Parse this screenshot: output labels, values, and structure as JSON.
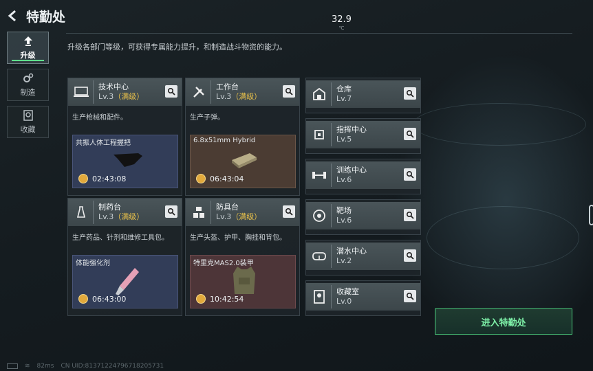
{
  "header": {
    "title": "特勤处",
    "temperature": "32.9",
    "temperature_unit": "℃"
  },
  "description": "升级各部门等级，可获得专属能力提升，和制造战斗物资的能力。",
  "sidebar": [
    {
      "label": "升级",
      "icon": "upgrade-icon",
      "active": true
    },
    {
      "label": "制造",
      "icon": "gears-icon",
      "active": false
    },
    {
      "label": "收藏",
      "icon": "collection-icon",
      "active": false
    }
  ],
  "departments": [
    {
      "name": "技术中心",
      "level": "Lv.3",
      "max": "（满级）",
      "desc": "生产枪械和配件。",
      "icon": "tech-center-icon",
      "item": "共振人体工程握把",
      "time": "02:43:08",
      "item_color": "#323d58"
    },
    {
      "name": "工作台",
      "level": "Lv.3",
      "max": "（满级）",
      "desc": "生产子弹。",
      "icon": "workbench-icon",
      "item": "6.8x51mm Hybrid",
      "time": "06:43:04",
      "item_color": "#4b3c33"
    },
    {
      "name": "制药台",
      "level": "Lv.3",
      "max": "（满级）",
      "desc": "生产药品、针剂和维修工具包。",
      "icon": "pharmacy-icon",
      "item": "体能强化剂",
      "time": "06:43:00",
      "item_color": "#323d58"
    },
    {
      "name": "防具台",
      "level": "Lv.3",
      "max": "（满级）",
      "desc": "生产头盔、护甲、胸挂和背包。",
      "icon": "armor-bench-icon",
      "item": "特里克MAS2.0装甲",
      "time": "10:42:54",
      "item_color": "#4d3538"
    }
  ],
  "facilities": [
    {
      "name": "仓库",
      "level": "Lv.7",
      "icon": "warehouse-icon"
    },
    {
      "name": "指挥中心",
      "level": "Lv.5",
      "icon": "command-chip-icon"
    },
    {
      "name": "训练中心",
      "level": "Lv.6",
      "icon": "dumbbell-icon"
    },
    {
      "name": "靶场",
      "level": "Lv.6",
      "icon": "target-icon"
    },
    {
      "name": "潜水中心",
      "level": "Lv.2",
      "icon": "diving-mask-icon"
    },
    {
      "name": "收藏室",
      "level": "Lv.0",
      "icon": "collection-room-icon"
    }
  ],
  "enter_button": "进入特勤处",
  "footer": {
    "ping": "82ms",
    "uid": "CN UID:813712247967182057​31"
  }
}
